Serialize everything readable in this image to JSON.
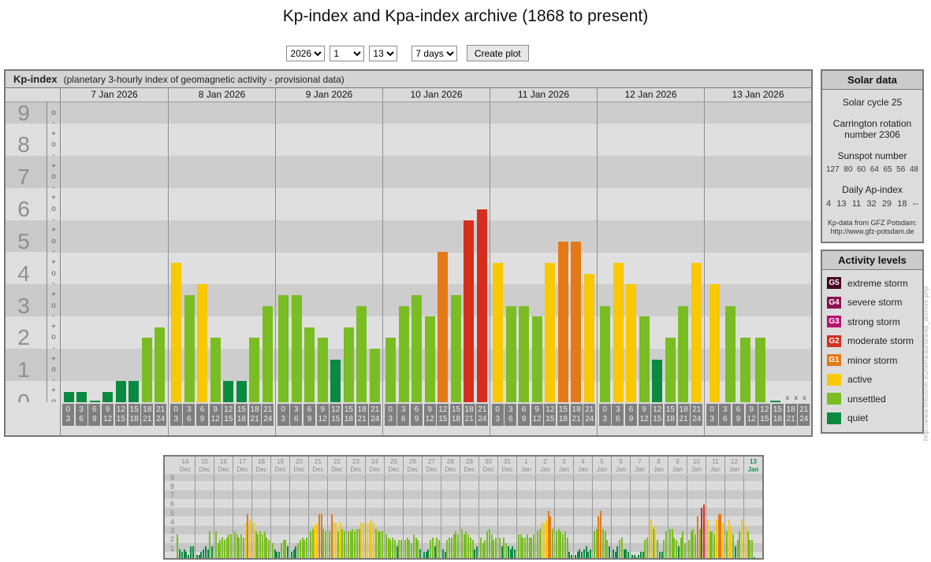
{
  "title": "Kp-index and Kpa-index archive (1868 to present)",
  "controls": {
    "year": "2026",
    "month": "1",
    "day": "13",
    "range": "7 days",
    "create_button": "Create plot"
  },
  "main_panel": {
    "heading": "Kp-index",
    "subtitle": "(planetary 3-hourly index of geomagnetic activity - provisional data)"
  },
  "solar_data": {
    "heading": "Solar data",
    "cycle": "Solar cycle 25",
    "carrington": "Carrington rotation number 2306",
    "sunspot_label": "Sunspot number",
    "sunspot_values": [
      "127",
      "80",
      "60",
      "64",
      "65",
      "56",
      "48"
    ],
    "ap_label": "Daily Ap-index",
    "ap_values": [
      "4",
      "13",
      "11",
      "32",
      "29",
      "18",
      "--"
    ],
    "source_line1": "Kp-data from GFZ Potsdam:",
    "source_line2": "http://www.gfz-potsdam.de"
  },
  "activity_levels": {
    "heading": "Activity levels",
    "items": [
      {
        "key": "g5",
        "code": "G5",
        "label": "extreme storm",
        "color": "#450022"
      },
      {
        "key": "g4",
        "code": "G4",
        "label": "severe storm",
        "color": "#8b1250"
      },
      {
        "key": "g3",
        "code": "G3",
        "label": "strong storm",
        "color": "#b80f70"
      },
      {
        "key": "g2",
        "code": "G2",
        "label": "moderate storm",
        "color": "#d52e1e"
      },
      {
        "key": "g1",
        "code": "G1",
        "label": "minor storm",
        "color": "#e47917"
      },
      {
        "key": "active",
        "code": "",
        "label": "active",
        "color": "#f8c800"
      },
      {
        "key": "unsettled",
        "code": "",
        "label": "unsettled",
        "color": "#79bd23"
      },
      {
        "key": "quiet",
        "code": "",
        "label": "quiet",
        "color": "#0a8a40"
      }
    ]
  },
  "watermark": "http://www.theusner.eu/terra/aurora/kp_archive.php",
  "chart_data": [
    {
      "type": "bar",
      "title": "Kp-index 7 days",
      "ylabel": "Kp",
      "ylim": [
        0,
        9.33
      ],
      "y_ticks": [
        9,
        8,
        7,
        6,
        5,
        4,
        3,
        2,
        1,
        0
      ],
      "sub_tick_labels": [
        "-",
        "o",
        "+"
      ],
      "grid": true,
      "legend_position": "right-panel",
      "missing_marker": "x",
      "hour_labels_top": [
        "0",
        "3",
        "6",
        "9",
        "12",
        "15",
        "18",
        "21"
      ],
      "hour_labels_bottom": [
        "3",
        "6",
        "9",
        "12",
        "15",
        "18",
        "21",
        "24"
      ],
      "days": [
        {
          "label": "7 Jan 2026",
          "values": [
            0.33,
            0.33,
            0,
            0.33,
            0.67,
            0.67,
            2,
            2.33
          ]
        },
        {
          "label": "8 Jan 2026",
          "values": [
            4.33,
            3.33,
            3.67,
            2,
            0.67,
            0.67,
            2,
            3
          ]
        },
        {
          "label": "9 Jan 2026",
          "values": [
            3.33,
            3.33,
            2.33,
            2,
            1.33,
            2.33,
            3,
            1.67
          ]
        },
        {
          "label": "10 Jan 2026",
          "values": [
            2,
            3,
            3.33,
            2.67,
            4.67,
            3.33,
            5.67,
            6
          ]
        },
        {
          "label": "11 Jan 2026",
          "values": [
            4.33,
            3,
            3,
            2.67,
            4.33,
            5,
            5,
            4
          ]
        },
        {
          "label": "12 Jan 2026",
          "values": [
            3,
            4.33,
            3.67,
            2.67,
            1.33,
            2,
            3,
            4.33
          ]
        },
        {
          "label": "13 Jan 2026",
          "values": [
            3.67,
            3,
            2,
            2,
            0,
            null,
            null,
            null
          ]
        }
      ]
    },
    {
      "type": "bar",
      "title": "Kp-index 31 day overview",
      "ylim": [
        0,
        9.33
      ],
      "y_ticks": [
        9,
        8,
        7,
        6,
        5,
        4,
        3,
        2,
        1
      ],
      "days": [
        {
          "day": "14",
          "mon": "Dec",
          "values": [
            2.67,
            1,
            0.67,
            1,
            0.67,
            0.33,
            1.33,
            1.33
          ]
        },
        {
          "day": "15",
          "mon": "Dec",
          "values": [
            0.33,
            0.33,
            0.67,
            1,
            1.33,
            1,
            3,
            1.33
          ]
        },
        {
          "day": "16",
          "mon": "Dec",
          "values": [
            3,
            1.67,
            2,
            2.33,
            2,
            2.33,
            2.67,
            2.67
          ]
        },
        {
          "day": "17",
          "mon": "Dec",
          "values": [
            3,
            2.67,
            2.33,
            2.67,
            2.33,
            4,
            5,
            4.33
          ]
        },
        {
          "day": "18",
          "mon": "Dec",
          "values": [
            4,
            3,
            2.67,
            3,
            2.67,
            3,
            2.33,
            2
          ]
        },
        {
          "day": "19",
          "mon": "Dec",
          "values": [
            1.67,
            1,
            0.67,
            0.67,
            1.67,
            2,
            2,
            1.33
          ]
        },
        {
          "day": "20",
          "mon": "Dec",
          "values": [
            0.67,
            1,
            1.33,
            1.67,
            2,
            2.33,
            2,
            2.33
          ]
        },
        {
          "day": "21",
          "mon": "Dec",
          "values": [
            3,
            3.33,
            3.67,
            4,
            5,
            5,
            3.33,
            3
          ]
        },
        {
          "day": "22",
          "mon": "Dec",
          "values": [
            3,
            5,
            4,
            4,
            3,
            4,
            3.33,
            3
          ]
        },
        {
          "day": "23",
          "mon": "Dec",
          "values": [
            3,
            3,
            3.33,
            3,
            3.33,
            3.33,
            4,
            4
          ]
        },
        {
          "day": "24",
          "mon": "Dec",
          "values": [
            4,
            4,
            4.33,
            4,
            3.33,
            3,
            3,
            3
          ]
        },
        {
          "day": "25",
          "mon": "Dec",
          "values": [
            2.67,
            2.33,
            2,
            2.33,
            2,
            1.33,
            2,
            2
          ]
        },
        {
          "day": "26",
          "mon": "Dec",
          "values": [
            2,
            2.33,
            2,
            1.67,
            2.67,
            2.33,
            2,
            1
          ]
        },
        {
          "day": "27",
          "mon": "Dec",
          "values": [
            0.67,
            0.67,
            1,
            2,
            2.33,
            1.33,
            2.33,
            2
          ]
        },
        {
          "day": "28",
          "mon": "Dec",
          "values": [
            1,
            0.67,
            2,
            2.33,
            2.33,
            2.67,
            3,
            2.67
          ]
        },
        {
          "day": "29",
          "mon": "Dec",
          "values": [
            3.33,
            2.67,
            3,
            2.67,
            2.33,
            2,
            1,
            1.33
          ]
        },
        {
          "day": "30",
          "mon": "Dec",
          "values": [
            2.33,
            1.67,
            2,
            3,
            3.33,
            2.67,
            2,
            2.33
          ]
        },
        {
          "day": "31",
          "mon": "Dec",
          "values": [
            2.33,
            1.33,
            2.33,
            1.67,
            1.33,
            1,
            1.33,
            1
          ]
        },
        {
          "day": "1",
          "mon": "Jan",
          "values": [
            2.67,
            2.67,
            2.33,
            2.33,
            2.67,
            2.33,
            2.33,
            2.67
          ]
        },
        {
          "day": "2",
          "mon": "Jan",
          "values": [
            3,
            3.33,
            4,
            4,
            4.33,
            5.33,
            4.67,
            3.33
          ]
        },
        {
          "day": "3",
          "mon": "Jan",
          "values": [
            3,
            3.33,
            3,
            2.67,
            3,
            2.33,
            0.67,
            0.33
          ]
        },
        {
          "day": "4",
          "mon": "Jan",
          "values": [
            0.33,
            0.67,
            1,
            0.67,
            1,
            1.33,
            0.67,
            1
          ]
        },
        {
          "day": "5",
          "mon": "Jan",
          "values": [
            3,
            3.33,
            4.67,
            5.33,
            3.33,
            3,
            2,
            1.33
          ]
        },
        {
          "day": "6",
          "mon": "Jan",
          "values": [
            1,
            0.67,
            1.33,
            2,
            2.33,
            1,
            1,
            0.67
          ]
        },
        {
          "day": "7",
          "mon": "Jan",
          "values": [
            0.33,
            0.33,
            0,
            0.33,
            0.67,
            0.67,
            2,
            2.33
          ]
        },
        {
          "day": "8",
          "mon": "Jan",
          "values": [
            4.33,
            3.33,
            3.67,
            2,
            0.67,
            0.67,
            2,
            3
          ]
        },
        {
          "day": "9",
          "mon": "Jan",
          "values": [
            3.33,
            3.33,
            2.33,
            2,
            1.33,
            2.33,
            3,
            1.67
          ]
        },
        {
          "day": "10",
          "mon": "Jan",
          "values": [
            2,
            3,
            3.33,
            2.67,
            4.67,
            3.33,
            5.67,
            6
          ]
        },
        {
          "day": "11",
          "mon": "Jan",
          "values": [
            4.33,
            3,
            3,
            2.67,
            4.33,
            5,
            5,
            4
          ]
        },
        {
          "day": "12",
          "mon": "Jan",
          "values": [
            3,
            4.33,
            3.67,
            2.67,
            1.33,
            2,
            3,
            4.33
          ]
        },
        {
          "day": "13",
          "mon": "Jan",
          "current": true,
          "values": [
            3.67,
            3,
            2,
            2,
            0,
            null,
            null,
            null
          ]
        }
      ]
    }
  ]
}
